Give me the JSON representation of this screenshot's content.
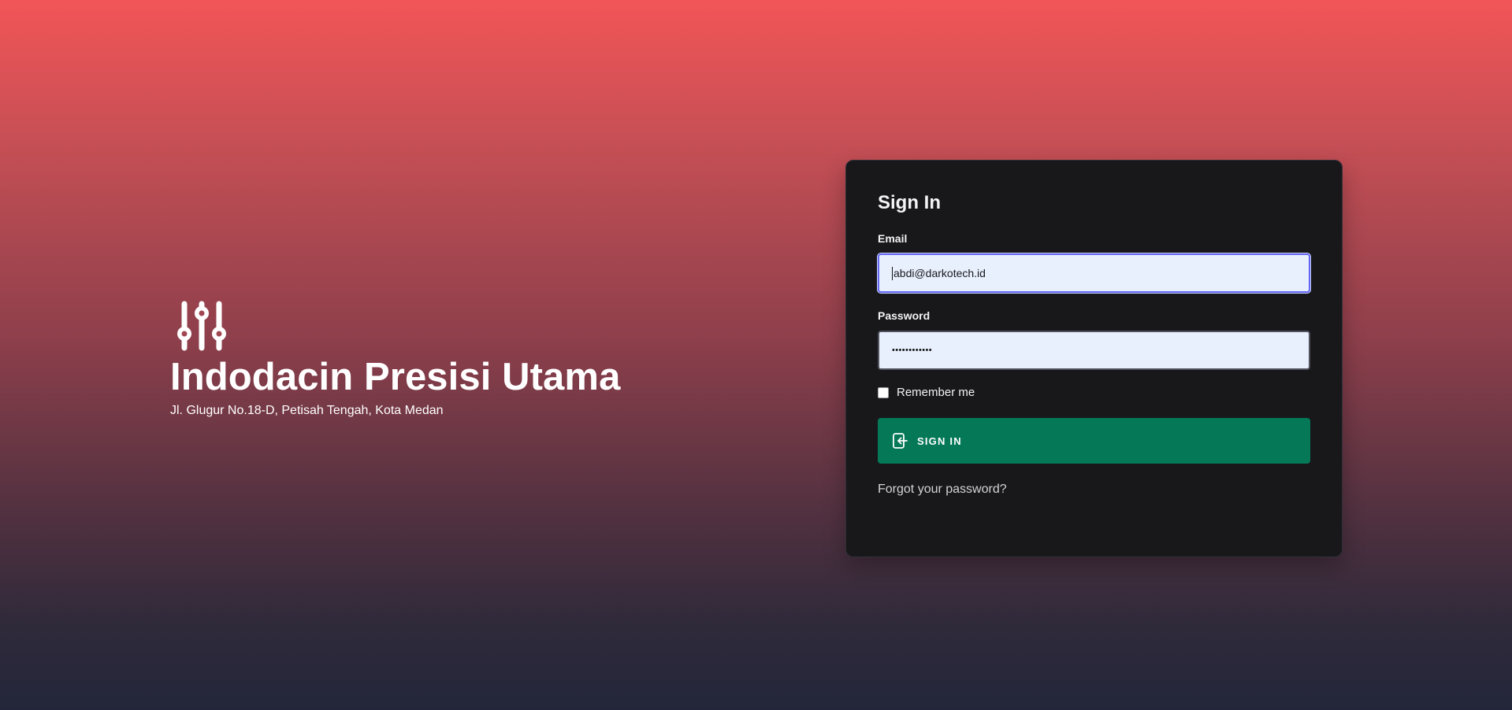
{
  "brand": {
    "icon": "adjustments-sliders-icon",
    "title": "Indodacin Presisi Utama",
    "address": "Jl. Glugur No.18-D, Petisah Tengah, Kota Medan"
  },
  "login": {
    "heading": "Sign In",
    "email": {
      "label": "Email",
      "value": "abdi@darkotech.id"
    },
    "password": {
      "label": "Password",
      "masked_value": "••••••••••••"
    },
    "remember": {
      "label": "Remember me",
      "checked": false
    },
    "submit": {
      "label": "SIGN IN",
      "icon": "login-icon"
    },
    "forgot_link": "Forgot your password?"
  },
  "colors": {
    "gradient_top": "#f25557",
    "gradient_bottom": "#23263a",
    "card_background": "#18181b",
    "button_background": "#047857",
    "input_background": "#e8f0fe",
    "focus_border": "#6366f1"
  }
}
